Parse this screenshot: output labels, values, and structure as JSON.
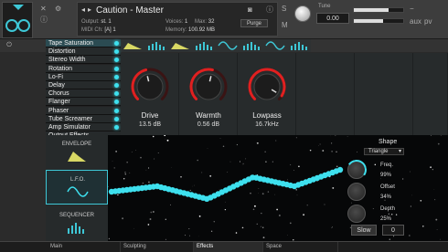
{
  "header": {
    "title": "Caution - Master",
    "output_label": "Output:",
    "output_value": "st. 1",
    "midi_label": "MIDI Ch:",
    "midi_value": "[A] 1",
    "voices_label": "Voices:",
    "voices_value": "1",
    "max_label": "Max:",
    "max_value": "32",
    "memory_label": "Memory:",
    "memory_value": "100.92 MB",
    "purge_label": "Purge",
    "tune_label": "Tune",
    "tune_value": "0.00"
  },
  "effects": {
    "items": [
      {
        "label": "Tape Saturation",
        "active": true
      },
      {
        "label": "Distortion",
        "active": false
      },
      {
        "label": "Stereo Width",
        "active": false
      },
      {
        "label": "Rotation",
        "active": false
      },
      {
        "label": "Lo-Fi",
        "active": false
      },
      {
        "label": "Delay",
        "active": false
      },
      {
        "label": "Chorus",
        "active": false
      },
      {
        "label": "Flanger",
        "active": false
      },
      {
        "label": "Phaser",
        "active": false
      },
      {
        "label": "Tube Screamer",
        "active": false
      },
      {
        "label": "Amp Simulator",
        "active": false
      },
      {
        "label": "Output Effects",
        "active": false
      }
    ]
  },
  "knobs": [
    {
      "label": "Drive",
      "value": "13.5 dB",
      "level": 0.45
    },
    {
      "label": "Warmth",
      "value": "0.56 dB",
      "level": 0.55
    },
    {
      "label": "Lowpass",
      "value": "16.7kHz",
      "level": 0.95
    }
  ],
  "mod_tabs": [
    {
      "label": "ENVELOPE",
      "icon": "envelope-shape-icon",
      "active": false
    },
    {
      "label": "L.F.O.",
      "icon": "sine-wave-icon",
      "active": true
    },
    {
      "label": "SEQUENCER",
      "icon": "step-bars-icon",
      "active": false
    }
  ],
  "lfo": {
    "shape_label": "Shape",
    "shape_value": "Triangle",
    "freq_label": "Freq.",
    "freq_value": "99%",
    "offset_label": "Offset",
    "offset_value": "34%",
    "depth_label": "Depth",
    "depth_value": "25%",
    "slow_label": "Slow",
    "zero_value": "0"
  },
  "bottom_nav": {
    "tabs": [
      {
        "label": "Main",
        "active": false
      },
      {
        "label": "Sculpting",
        "active": false
      },
      {
        "label": "Effects",
        "active": true
      },
      {
        "label": "Space",
        "active": false
      }
    ]
  },
  "colors": {
    "accent": "#3ee0ee",
    "knob_arc": "#e02020"
  }
}
